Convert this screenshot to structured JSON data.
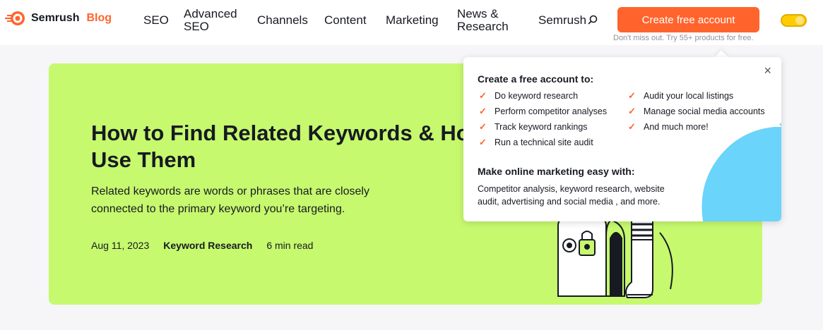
{
  "header": {
    "brand": "Semrush",
    "blog": "Blog",
    "nav": [
      "SEO",
      "Advanced SEO",
      "Channels",
      "Content",
      "Marketing",
      "News & Research",
      "Semrush"
    ],
    "cta_label": "Create free account",
    "cta_sub": "Don't miss out. Try 55+ products for free."
  },
  "hero": {
    "title": "How to Find Related Keywords & How to Use Them",
    "description": "Related keywords are words or phrases that are closely connected to the primary keyword you’re targeting.",
    "date": "Aug 11, 2023",
    "category": "Keyword Research",
    "read_time": "6 min read"
  },
  "popup": {
    "close": "×",
    "heading": "Create a free account to:",
    "left_items": [
      "Do keyword research",
      "Perform competitor analyses",
      "Track keyword rankings",
      "Run a technical site audit"
    ],
    "right_items": [
      "Audit your local listings",
      "Manage social media accounts",
      "And much more!"
    ],
    "heading2": "Make online marketing easy with:",
    "description": "Competitor analysis, keyword research, website audit, advertising and social media , and more."
  },
  "colors": {
    "accent": "#ff642d",
    "hero_bg": "#c6f96e",
    "toggle": "#ffcc00",
    "blob": "#6ad4fb"
  },
  "icons": [
    "semrush-logo-icon",
    "search-icon",
    "check-icon",
    "close-icon"
  ]
}
